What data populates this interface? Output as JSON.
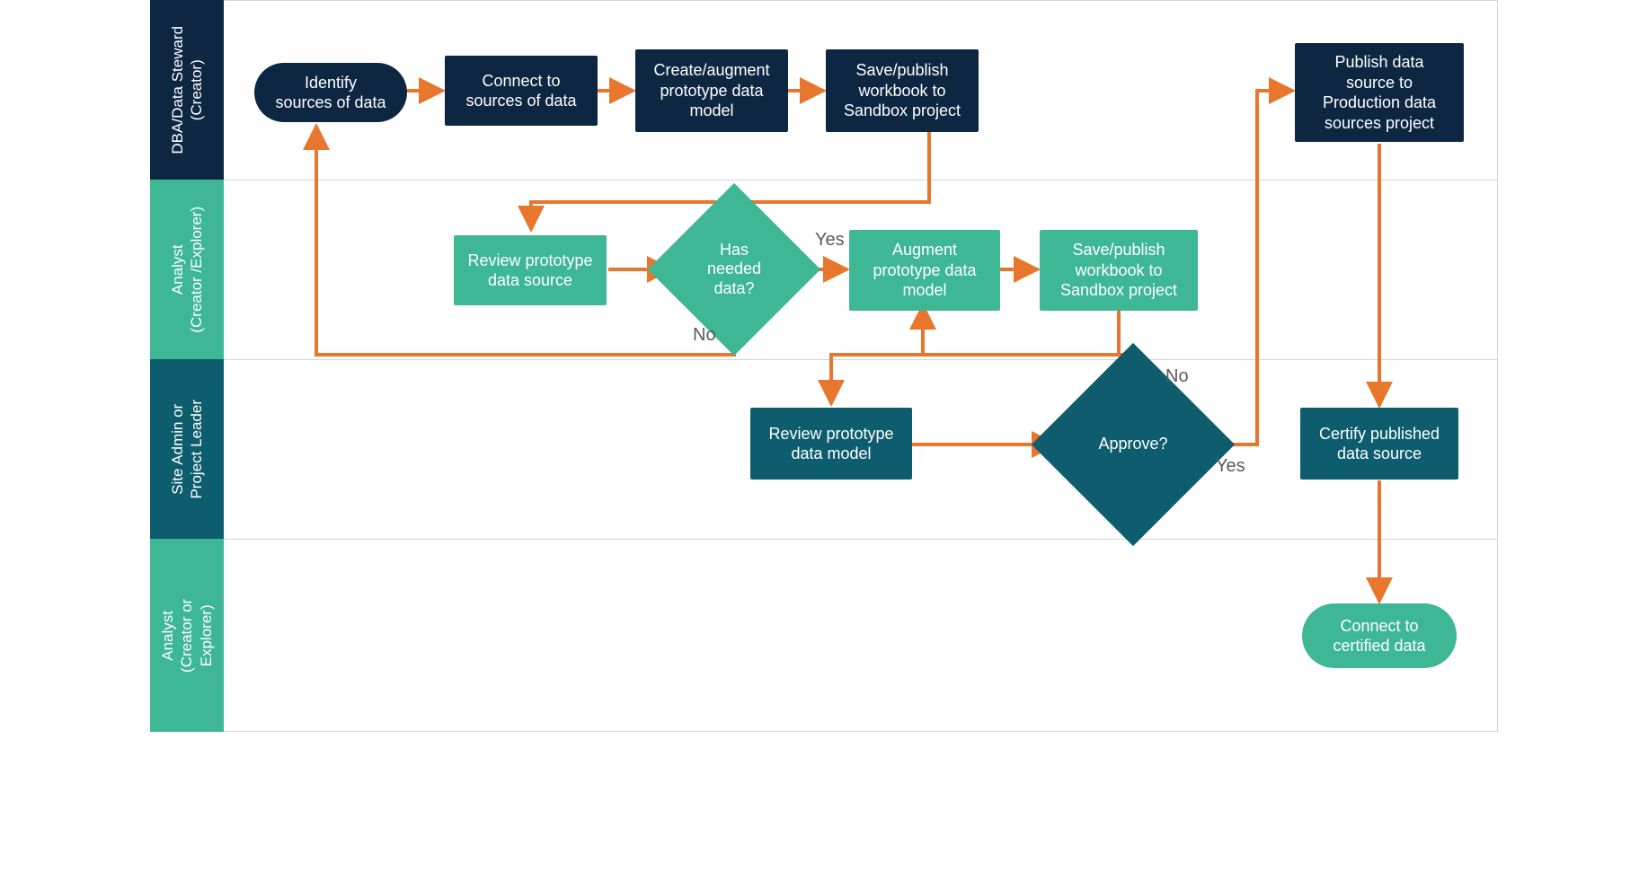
{
  "roles": {
    "dba": "DBA/Data Steward\n(Creator)",
    "analyst1": "Analyst\n(Creator /Explorer)",
    "admin": "Site Admin or\nProject Leader",
    "analyst2": "Analyst\n(Creator or\nExplorer)"
  },
  "nodes": {
    "identify": "Identify\nsources of data",
    "connect": "Connect to\nsources of data",
    "create_model": "Create/augment\nprototype data\nmodel",
    "save_sandbox1": "Save/publish\nworkbook to\nSandbox project",
    "publish_prod": "Publish data\nsource  to\nProduction data\nsources project",
    "review_src": "Review prototype\ndata source",
    "has_data": "Has\nneeded\ndata?",
    "augment": "Augment\nprototype data\nmodel",
    "save_sandbox2": "Save/publish\nworkbook to\nSandbox project",
    "review_model": "Review prototype\ndata model",
    "approve": "Approve?",
    "certify": "Certify published\ndata source",
    "connect_cert": "Connect to\ncertified data"
  },
  "edge_labels": {
    "yes1": "Yes",
    "no1": "No",
    "yes2": "Yes",
    "no2": "No"
  },
  "colors": {
    "navy": "#0d2743",
    "mint": "#3eb795",
    "teal": "#0d5d6e",
    "arrow": "#e8762c",
    "edge_text": "#5b5b5b"
  }
}
